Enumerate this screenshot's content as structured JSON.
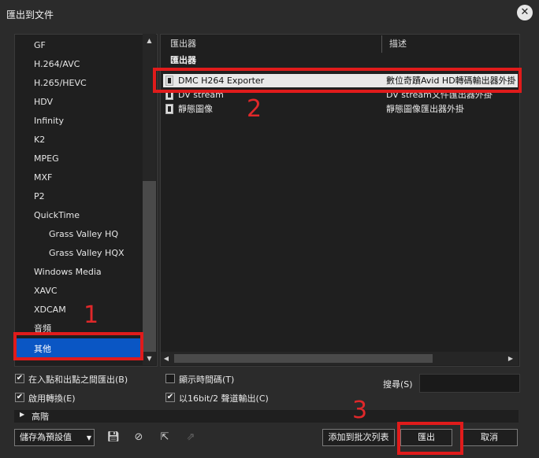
{
  "window": {
    "title": "匯出到文件",
    "close_icon": "close-icon"
  },
  "tree": {
    "items": [
      {
        "label": "GF",
        "indent": 0
      },
      {
        "label": "H.264/AVC",
        "indent": 0
      },
      {
        "label": "H.265/HEVC",
        "indent": 0
      },
      {
        "label": "HDV",
        "indent": 0
      },
      {
        "label": "Infinity",
        "indent": 0
      },
      {
        "label": "K2",
        "indent": 0
      },
      {
        "label": "MPEG",
        "indent": 0
      },
      {
        "label": "MXF",
        "indent": 0
      },
      {
        "label": "P2",
        "indent": 0
      },
      {
        "label": "QuickTime",
        "indent": 0
      },
      {
        "label": "Grass Valley HQ",
        "indent": 1
      },
      {
        "label": "Grass Valley HQX",
        "indent": 1
      },
      {
        "label": "Windows Media",
        "indent": 0
      },
      {
        "label": "XAVC",
        "indent": 0
      },
      {
        "label": "XDCAM",
        "indent": 0
      },
      {
        "label": "音頻",
        "indent": 0
      },
      {
        "label": "其他",
        "indent": 0,
        "selected": true
      }
    ]
  },
  "exporters": {
    "col_exporter": "匯出器",
    "col_desc": "描述",
    "group": "匯出器",
    "rows": [
      {
        "name": "DMC H264 Exporter",
        "desc": "數位奇蹟Avid HD轉碼輸出器外掛",
        "selected": true
      },
      {
        "name": "DV stream",
        "desc": "DV stream文件匯出器外掛",
        "selected": false
      },
      {
        "name": "靜態圖像",
        "desc": "靜態圖像匯出器外掛",
        "selected": false
      }
    ]
  },
  "options": {
    "in_out_label": "在入點和出點之間匯出(B)",
    "in_out_checked": true,
    "show_timecode_label": "顯示時間碼(T)",
    "show_timecode_checked": false,
    "enable_convert_label": "啟用轉換(E)",
    "enable_convert_checked": true,
    "output_16bit_label": "以16bit/2 聲道輸出(C)",
    "output_16bit_checked": true,
    "search_label": "搜尋(S)",
    "search_value": ""
  },
  "advanced": {
    "label": "高階"
  },
  "footer": {
    "preset_value": "儲存為預設值",
    "add_batch_label": "添加到批次列表",
    "export_label": "匯出",
    "cancel_label": "取消",
    "icons": [
      "save-icon",
      "delete-preset-icon",
      "import-preset-icon",
      "export-preset-icon"
    ]
  },
  "annotations": {
    "n1": "1",
    "n2": "2",
    "n3": "3",
    "color": "#e01b1b"
  }
}
